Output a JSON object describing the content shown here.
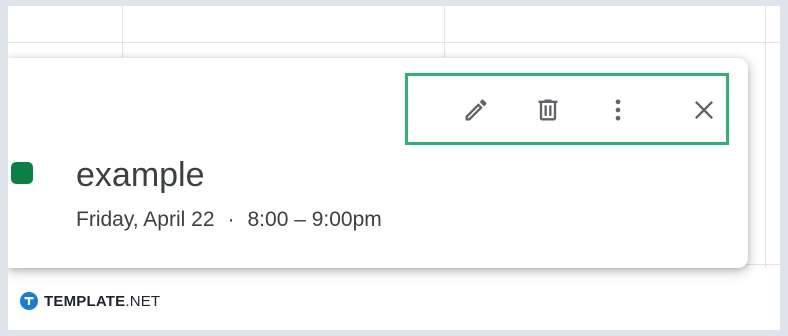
{
  "event": {
    "title": "example",
    "date": "Friday, April 22",
    "separator": "·",
    "time": "8:00 – 9:00pm",
    "calendar_color": "#0b8043"
  },
  "toolbar": {
    "highlight_color": "#2fb277",
    "icon_color": "#5f6368",
    "buttons": [
      {
        "name": "edit",
        "icon": "pencil-icon"
      },
      {
        "name": "delete",
        "icon": "trash-icon"
      },
      {
        "name": "options",
        "icon": "more-vert-icon"
      },
      {
        "name": "close",
        "icon": "close-icon"
      }
    ]
  },
  "watermark": {
    "brand_bold": "TEMPLATE",
    "brand_rest": ".NET",
    "brand_color": "#1a7bd8",
    "icon": "template-t-icon"
  }
}
